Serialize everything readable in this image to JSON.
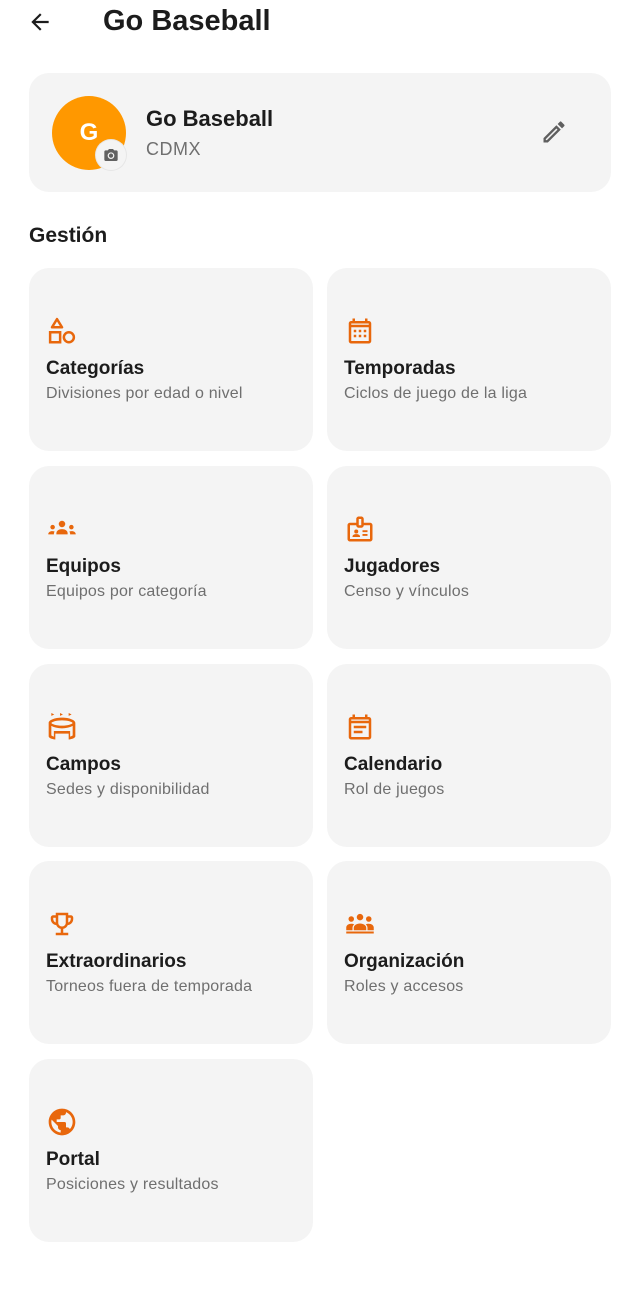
{
  "appbar": {
    "title": "Go Baseball",
    "back_icon": "arrow-back-icon"
  },
  "profile": {
    "initial": "G",
    "name": "Go Baseball",
    "city": "CDMX",
    "avatar_color": "#ff9800",
    "camera_icon": "camera-icon",
    "edit_icon": "pencil-icon"
  },
  "section": {
    "title": "Gestión"
  },
  "accent_color": "#e8670c",
  "tiles": [
    {
      "title": "Categorías",
      "subtitle": "Divisiones por edad o nivel",
      "icon": "shapes-icon"
    },
    {
      "title": "Temporadas",
      "subtitle": "Ciclos de juego de la liga",
      "icon": "calendar-grid-icon"
    },
    {
      "title": "Equipos",
      "subtitle": "Equipos por categoría",
      "icon": "groups-icon"
    },
    {
      "title": "Jugadores",
      "subtitle": "Censo y vínculos",
      "icon": "badge-icon"
    },
    {
      "title": "Campos",
      "subtitle": "Sedes y disponibilidad",
      "icon": "stadium-icon"
    },
    {
      "title": "Calendario",
      "subtitle": "Rol de juegos",
      "icon": "event-note-icon"
    },
    {
      "title": "Extraordinarios",
      "subtitle": "Torneos fuera de temporada",
      "icon": "trophy-icon"
    },
    {
      "title": "Organización",
      "subtitle": "Roles y accesos",
      "icon": "people-icon"
    },
    {
      "title": "Portal",
      "subtitle": "Posiciones y resultados",
      "icon": "globe-icon"
    }
  ]
}
